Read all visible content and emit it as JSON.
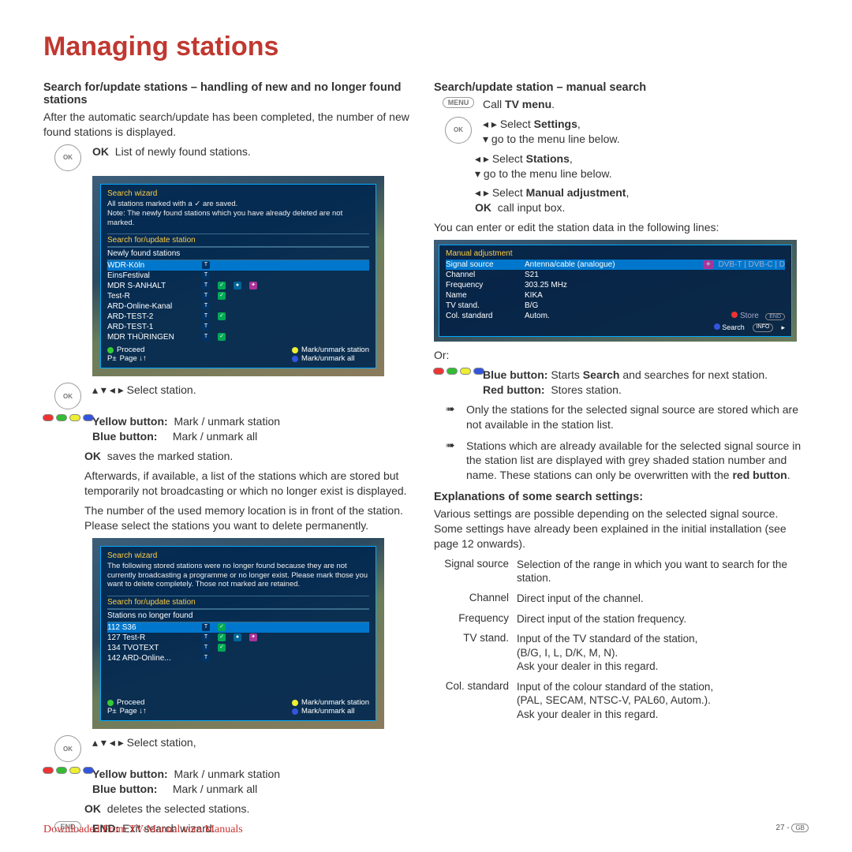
{
  "title": "Managing stations",
  "left": {
    "h_new": "Search for/update stations – handling of new and no longer found stations",
    "intro_new": "After the automatic search/update has been completed, the number of new found stations is displayed.",
    "ok_list": "List of newly found stations.",
    "select_station": "Select station.",
    "yellow_lbl": "Yellow button:",
    "yellow_val": "Mark / unmark station",
    "blue_lbl": "Blue button:",
    "blue_val": "Mark / unmark all",
    "ok_saves": "saves the marked station.",
    "after1": "Afterwards, if available, a list of the stations which are stored but temporarily not broadcasting or which no longer exist is displayed.",
    "after2": "The number of the used memory location is in front of the station. Please select the stations you want to delete permanently.",
    "select_station2": "Select station,",
    "ok_deletes": "deletes the selected stations.",
    "end_lbl": "END:",
    "end_val": "Exit search wizard.",
    "ss1": {
      "title": "Search wizard",
      "note1": "All stations marked with a ✓ are saved.",
      "note2": "Note: The newly found stations which you have already deleted are not marked.",
      "sec": "Search for/update station",
      "sec2": "Newly found stations",
      "rows": [
        "WDR-Köln",
        "EinsFestival",
        "MDR S-ANHALT",
        "Test-R",
        "ARD-Online-Kanal",
        "ARD-TEST-2",
        "ARD-TEST-1",
        "MDR THÜRINGEN"
      ],
      "f_proceed": "Proceed",
      "f_page": "Page ↓↑",
      "f_mark": "Mark/unmark station",
      "f_markall": "Mark/unmark all"
    },
    "ss2": {
      "title": "Search wizard",
      "note": "The following stored stations were no longer found because they are not currently broadcasting a programme or no longer exist. Please mark those you want to delete completely. Those not marked are retained.",
      "sec": "Search for/update station",
      "sec2": "Stations no longer found",
      "rows": [
        "112 S36",
        "127 Test-R",
        "134 TVOTEXT",
        "142 ARD-Online..."
      ],
      "f_proceed": "Proceed",
      "f_page": "Page ↓↑",
      "f_mark": "Mark/unmark station",
      "f_markall": "Mark/unmark all"
    }
  },
  "right": {
    "h_manual": "Search/update station – manual search",
    "call_tv": "Call ",
    "tv_menu": "TV menu",
    "sel_settings_pre": "Select ",
    "sel_settings": "Settings",
    "goto_line": "go to the menu line below.",
    "sel_stations": "Stations",
    "sel_manual": "Manual adjustment",
    "call_input": "call input box.",
    "enter_lines": "You can enter or edit the station data in the following lines:",
    "ss3": {
      "title": "Manual adjustment",
      "rows": [
        {
          "l": "Signal source",
          "v": "Antenna/cable (analogue)",
          "r": "DVB-T | DVB-C | D"
        },
        {
          "l": "Channel",
          "v": "S21",
          "r": ""
        },
        {
          "l": "Frequency",
          "v": "303.25 MHz",
          "r": ""
        },
        {
          "l": "Name",
          "v": "KIKA",
          "r": ""
        },
        {
          "l": "TV stand.",
          "v": "B/G",
          "r": ""
        },
        {
          "l": "Col. standard",
          "v": "Autom.",
          "r": ""
        }
      ],
      "store": "Store",
      "search": "Search",
      "end": "END",
      "info": "INFO"
    },
    "or": "Or:",
    "blue_starts": "Starts ",
    "blue_search": "Search",
    "blue_rest": " and searches for next station.",
    "red_lbl": "Red button:",
    "red_val": "Stores station.",
    "bullet1": "Only the stations for the selected signal source are stored which are not available in the station list.",
    "bullet2_a": "Stations which are already available for the selected signal source in the station list are displayed with grey shaded station number and name. These stations can only be overwritten with the ",
    "bullet2_b": "red button",
    "h_explain": "Explanations of some search settings:",
    "explain_p": "Various settings are possible depending on the selected signal source. Some settings have already been explained in the initial installation (see page 12 onwards).",
    "kv": [
      {
        "k": "Signal source",
        "v": "Selection of the range in which you want to search for the station."
      },
      {
        "k": "Channel",
        "v": "Direct input of the channel."
      },
      {
        "k": "Frequency",
        "v": "Direct input of the station frequency."
      },
      {
        "k": "TV stand.",
        "v": "Input of the TV standard of the station,\n(B/G, I, L, D/K, M, N).\nAsk your dealer in this regard."
      },
      {
        "k": "Col. standard",
        "v": "Input of the colour standard of the station,\n(PAL, SECAM, NTSC-V, PAL60, Autom.).\nAsk your dealer in this regard."
      }
    ]
  },
  "footer": {
    "link": "Downloaded From TV-Manual.com Manuals",
    "page": "27 -",
    "gb": "GB"
  }
}
